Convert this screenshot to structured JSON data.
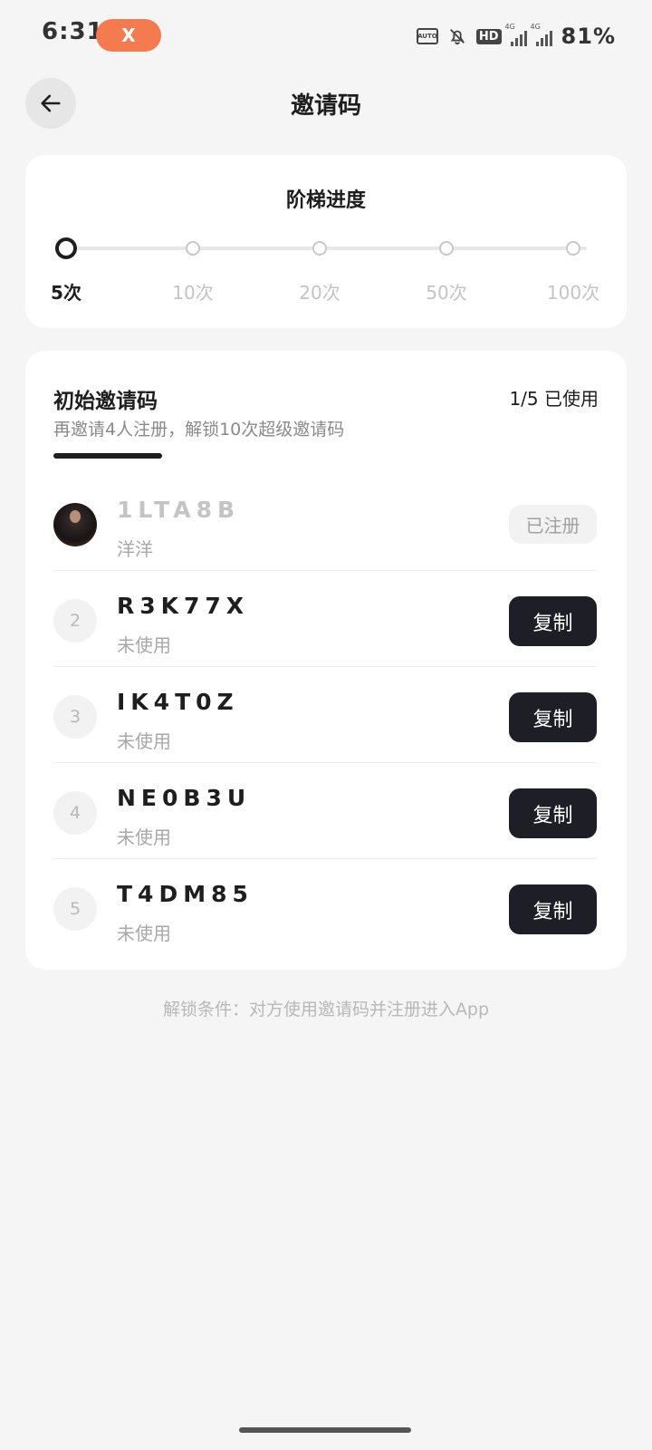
{
  "status_bar": {
    "time": "6:31",
    "x_badge": "X",
    "auto_label": "AUTO",
    "hd_label": "HD",
    "net1": "4G",
    "net2": "4G",
    "battery": "81%"
  },
  "header": {
    "title": "邀请码",
    "back_icon": "arrow-left-icon"
  },
  "progress": {
    "title": "阶梯进度",
    "current_index": 0,
    "steps": [
      "5次",
      "10次",
      "20次",
      "50次",
      "100次"
    ]
  },
  "codes_section": {
    "title": "初始邀请码",
    "usage": "1/5 已使用",
    "subtitle": "再邀请4人注册，解锁10次超级邀请码",
    "items": [
      {
        "marker": "",
        "code": "1LTA8B",
        "status": "洋洋",
        "action": "已注册",
        "used": true
      },
      {
        "marker": "2",
        "code": "R3K77X",
        "status": "未使用",
        "action": "复制",
        "used": false
      },
      {
        "marker": "3",
        "code": "IK4T0Z",
        "status": "未使用",
        "action": "复制",
        "used": false
      },
      {
        "marker": "4",
        "code": "NE0B3U",
        "status": "未使用",
        "action": "复制",
        "used": false
      },
      {
        "marker": "5",
        "code": "T4DM85",
        "status": "未使用",
        "action": "复制",
        "used": false
      }
    ]
  },
  "footer_note": "解锁条件：对方使用邀请码并注册进入App",
  "colors": {
    "background": "#f5f5f5",
    "card": "#ffffff",
    "primary_dark": "#1e1e26",
    "muted_text": "#a8a8a8",
    "x_badge": "#f47a4f"
  }
}
